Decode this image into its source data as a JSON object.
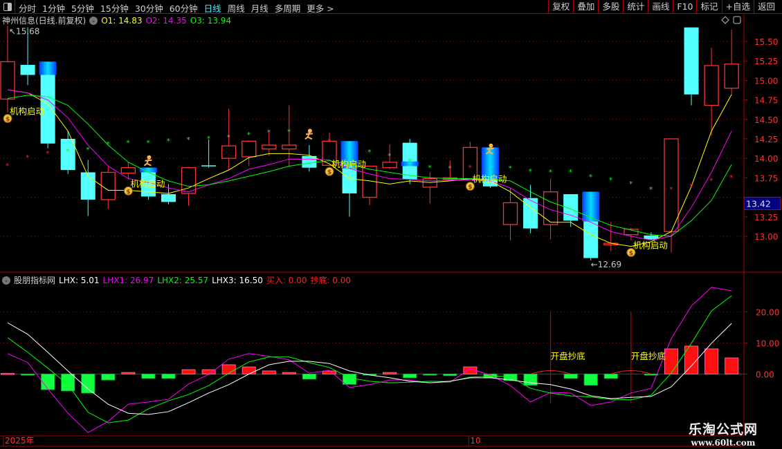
{
  "toolbar": {
    "periods": [
      "分时",
      "1分钟",
      "5分钟",
      "15分钟",
      "30分钟",
      "60分钟",
      "日线",
      "周线",
      "月线",
      "多周期",
      "更多 >"
    ],
    "active_period": "日线",
    "buttons": [
      "复权",
      "叠加",
      "多股",
      "统计",
      "画线",
      "F10",
      "标记",
      "+自选",
      "返回"
    ]
  },
  "main_header": {
    "title": "神州信息(日线.前复权)",
    "o1": "O1: 14.83",
    "o2": "O2: 14.35",
    "o3": "O3: 13.94"
  },
  "indicator_header": {
    "name": "股朋指标网",
    "lhx": "LHX: 5.01",
    "lhx1": "LHX1: 26.97",
    "lhx2": "LHX2: 25.57",
    "lhx3": "LHX3: 16.50",
    "buy": "买入: 0.00",
    "bottom": "抄底: 0.00"
  },
  "colors": {
    "up": "#ff3232",
    "down": "#54ffff",
    "ma1": "#ffff00",
    "ma2": "#ff00ff",
    "ma3": "#00ff00",
    "grid": "#a00000",
    "lhx3": "#ffffff"
  },
  "watermark": {
    "name": "乐淘公式网",
    "url": "www.60lt.com"
  },
  "time_axis": {
    "labels": [
      {
        "text": "2025年",
        "index": 0
      },
      {
        "text": "10",
        "index": 23
      }
    ]
  },
  "chart_data": [
    {
      "type": "candlestick",
      "title": "神州信息(日线.前复权)",
      "ylim": [
        12.55,
        15.75
      ],
      "yticks": [
        "15.50",
        "15.25",
        "15.00",
        "14.75",
        "14.50",
        "14.25",
        "14.00",
        "13.75",
        "13.25",
        "13.00"
      ],
      "ytick_values": [
        15.5,
        15.25,
        15.0,
        14.75,
        14.5,
        14.25,
        14.0,
        13.75,
        13.25,
        13.0
      ],
      "last_price_label": "13.42",
      "last_price": 13.42,
      "high_label": "15.68",
      "high_index": 1,
      "low_label": "12.69",
      "low_index": 29,
      "ohlc": [
        [
          14.76,
          15.7,
          14.59,
          15.24
        ],
        [
          15.2,
          15.68,
          14.94,
          15.07
        ],
        [
          15.24,
          15.24,
          14.13,
          14.19
        ],
        [
          14.25,
          14.35,
          13.8,
          13.85
        ],
        [
          13.82,
          13.98,
          13.26,
          13.47
        ],
        [
          13.47,
          13.89,
          13.35,
          13.82
        ],
        [
          13.81,
          13.95,
          13.73,
          13.88
        ],
        [
          13.88,
          13.88,
          13.47,
          13.51
        ],
        [
          13.54,
          13.67,
          13.41,
          13.44
        ],
        [
          13.55,
          13.89,
          13.39,
          13.88
        ],
        [
          13.91,
          14.24,
          13.88,
          13.9
        ],
        [
          14.0,
          14.64,
          13.85,
          14.16
        ],
        [
          14.02,
          14.23,
          13.9,
          14.22
        ],
        [
          14.12,
          14.33,
          14.03,
          14.17
        ],
        [
          14.12,
          14.68,
          13.89,
          14.17
        ],
        [
          14.03,
          14.17,
          13.83,
          13.88
        ],
        [
          13.91,
          14.33,
          13.9,
          14.22
        ],
        [
          14.22,
          14.22,
          13.25,
          13.55
        ],
        [
          13.5,
          13.9,
          13.4,
          13.9
        ],
        [
          13.88,
          14.18,
          13.86,
          13.95
        ],
        [
          14.2,
          14.25,
          13.67,
          13.73
        ],
        [
          13.63,
          13.82,
          13.42,
          13.74
        ],
        [
          13.73,
          13.97,
          13.72,
          13.75
        ],
        [
          13.73,
          14.21,
          13.72,
          14.14
        ],
        [
          14.14,
          14.14,
          13.62,
          13.64
        ],
        [
          13.15,
          13.62,
          12.95,
          13.43
        ],
        [
          13.49,
          13.66,
          13.04,
          13.1
        ],
        [
          13.15,
          13.74,
          12.96,
          13.57
        ],
        [
          13.54,
          13.54,
          13.12,
          13.2
        ],
        [
          13.57,
          13.57,
          12.69,
          12.72
        ],
        [
          12.89,
          13.18,
          12.81,
          12.91
        ],
        [
          13.02,
          13.11,
          12.95,
          13.09
        ],
        [
          13.01,
          13.05,
          12.95,
          12.96
        ],
        [
          13.06,
          14.25,
          12.79,
          14.25
        ],
        [
          15.68,
          15.68,
          14.68,
          14.82
        ],
        [
          14.68,
          15.42,
          14.29,
          15.19
        ],
        [
          14.9,
          15.65,
          14.82,
          15.21
        ]
      ],
      "highlight_bands": [
        {
          "index": 2,
          "from": 15.24,
          "to": 15.07
        },
        {
          "index": 7,
          "from": 13.88,
          "to": 13.82
        },
        {
          "index": 17,
          "from": 14.22,
          "to": 13.87
        },
        {
          "index": 20,
          "from": 13.96,
          "to": 13.9
        },
        {
          "index": 24,
          "from": 14.14,
          "to": 13.73
        },
        {
          "index": 29,
          "from": 13.57,
          "to": 13.19
        }
      ],
      "series": [
        {
          "name": "O1",
          "color": "#ffff00",
          "values": [
            14.88,
            14.84,
            14.7,
            14.35,
            13.77,
            13.59,
            13.59,
            13.57,
            13.55,
            13.62,
            13.74,
            13.85,
            14.01,
            14.06,
            14.06,
            14.04,
            13.93,
            13.74,
            13.71,
            13.67,
            13.71,
            13.69,
            13.71,
            13.74,
            13.71,
            13.57,
            13.37,
            13.18,
            13.18,
            13.02,
            12.91,
            12.87,
            12.93,
            13.06,
            13.64,
            14.35,
            14.82
          ]
        },
        {
          "name": "O2",
          "color": "#ff00ff",
          "values": [
            14.88,
            14.84,
            14.75,
            14.52,
            14.17,
            13.9,
            13.74,
            13.69,
            13.62,
            13.57,
            13.66,
            13.74,
            13.86,
            13.92,
            13.99,
            13.99,
            13.98,
            13.87,
            13.8,
            13.74,
            13.73,
            13.71,
            13.72,
            13.72,
            13.71,
            13.62,
            13.46,
            13.34,
            13.27,
            13.18,
            13.06,
            13.0,
            12.95,
            13.0,
            13.37,
            13.82,
            14.35
          ]
        },
        {
          "name": "O3",
          "color": "#00ff00",
          "values": [
            14.77,
            14.81,
            14.79,
            14.68,
            14.44,
            14.17,
            13.95,
            13.82,
            13.71,
            13.64,
            13.66,
            13.71,
            13.77,
            13.83,
            13.9,
            13.94,
            13.97,
            13.92,
            13.86,
            13.82,
            13.78,
            13.75,
            13.74,
            13.74,
            13.73,
            13.71,
            13.57,
            13.44,
            13.35,
            13.24,
            13.14,
            13.08,
            13.02,
            13.0,
            13.2,
            13.46,
            13.92
          ]
        }
      ],
      "stars": [
        {
          "i": 0,
          "p": 13.92,
          "c": "red"
        },
        {
          "i": 1,
          "p": 14.03,
          "c": "red"
        },
        {
          "i": 2,
          "p": 14.08,
          "c": "red"
        },
        {
          "i": 3,
          "p": 14.11,
          "c": "green"
        },
        {
          "i": 4,
          "p": 14.13,
          "c": "green"
        },
        {
          "i": 5,
          "p": 14.2,
          "c": "green"
        },
        {
          "i": 6,
          "p": 14.22,
          "c": "green"
        },
        {
          "i": 7,
          "p": 14.22,
          "c": "green"
        },
        {
          "i": 8,
          "p": 14.24,
          "c": "green"
        },
        {
          "i": 9,
          "p": 14.26,
          "c": "gray"
        },
        {
          "i": 10,
          "p": 14.27,
          "c": "green"
        },
        {
          "i": 11,
          "p": 14.29,
          "c": "gray"
        },
        {
          "i": 12,
          "p": 14.32,
          "c": "green"
        },
        {
          "i": 13,
          "p": 14.35,
          "c": "gray"
        },
        {
          "i": 14,
          "p": 14.36,
          "c": "green"
        },
        {
          "i": 15,
          "p": 14.33,
          "c": "gray"
        },
        {
          "i": 16,
          "p": 14.24,
          "c": "red"
        },
        {
          "i": 18,
          "p": 14.1,
          "c": "green"
        },
        {
          "i": 19,
          "p": 14.05,
          "c": "gray"
        },
        {
          "i": 20,
          "p": 13.98,
          "c": "green"
        },
        {
          "i": 21,
          "p": 13.9,
          "c": "green"
        },
        {
          "i": 22,
          "p": 13.89,
          "c": "gray"
        },
        {
          "i": 23,
          "p": 13.9,
          "c": "red"
        },
        {
          "i": 25,
          "p": 13.89,
          "c": "green"
        },
        {
          "i": 26,
          "p": 13.85,
          "c": "green"
        },
        {
          "i": 27,
          "p": 13.84,
          "c": "green"
        },
        {
          "i": 28,
          "p": 13.84,
          "c": "green"
        },
        {
          "i": 29,
          "p": 13.78,
          "c": "green"
        },
        {
          "i": 30,
          "p": 13.74,
          "c": "green"
        },
        {
          "i": 31,
          "p": 13.69,
          "c": "green"
        },
        {
          "i": 32,
          "p": 13.62,
          "c": "gray"
        },
        {
          "i": 33,
          "p": 13.62,
          "c": "red"
        },
        {
          "i": 34,
          "p": 13.66,
          "c": "red"
        },
        {
          "i": 35,
          "p": 13.73,
          "c": "red"
        },
        {
          "i": 36,
          "p": 13.77,
          "c": "red"
        }
      ],
      "signal_label": "机构启动",
      "signals": [
        {
          "i": 0,
          "p": 14.6
        },
        {
          "i": 6,
          "p": 13.67
        },
        {
          "i": 16,
          "p": 13.92
        },
        {
          "i": 23,
          "p": 13.73
        },
        {
          "i": 31,
          "p": 12.88
        }
      ],
      "runners": [
        {
          "i": 7,
          "p": 13.96
        },
        {
          "i": 15,
          "p": 14.3
        },
        {
          "i": 24,
          "p": 14.11
        }
      ]
    },
    {
      "type": "bar",
      "title": "股朋指标网",
      "ylim": [
        -22,
        30
      ],
      "yticks": [
        "20.00",
        "10.00",
        "0.00"
      ],
      "ytick_values": [
        20,
        10,
        0
      ],
      "histogram": [
        0.2,
        -0.3,
        -5.0,
        -5.4,
        -6.1,
        -1.9,
        0.5,
        -1.4,
        -1.4,
        1.4,
        1.4,
        3.0,
        2.3,
        1.0,
        0.5,
        -1.6,
        1.0,
        -3.3,
        -0.3,
        0.5,
        -1.2,
        -0.3,
        -0.5,
        2.3,
        -1.2,
        -2.1,
        -3.6,
        0,
        -1.4,
        -3.6,
        -1.4,
        0,
        -0.3,
        8.1,
        9.0,
        8.1,
        5.2
      ],
      "series": [
        {
          "name": "LHX1",
          "color": "#ff00ff",
          "values": [
            6.6,
            3.7,
            -4.8,
            -12.6,
            -18.8,
            -15.2,
            -9.7,
            -9.0,
            -8.1,
            -3.2,
            -0.1,
            4.8,
            6.6,
            5.7,
            4.6,
            0.3,
            1.2,
            -4.3,
            -3.4,
            -1.9,
            -1.9,
            -2.8,
            -2.6,
            1.7,
            -0.3,
            -3.7,
            -9.0,
            -5.9,
            -6.1,
            -10.1,
            -9.0,
            -6.1,
            -4.6,
            11.4,
            21.9,
            27.9,
            26.8
          ]
        },
        {
          "name": "LHX2",
          "color": "#00ff00",
          "values": [
            11.7,
            7.0,
            1.9,
            -3.4,
            -12.3,
            -15.7,
            -14.8,
            -11.2,
            -8.6,
            -6.6,
            -3.7,
            0.3,
            3.9,
            5.5,
            5.5,
            3.7,
            2.1,
            -1.2,
            -2.3,
            -2.8,
            -2.6,
            -2.3,
            -2.4,
            -1.0,
            -0.6,
            -0.8,
            -4.6,
            -6.1,
            -7.0,
            -7.4,
            -8.1,
            -8.3,
            -6.8,
            0.3,
            9.9,
            20.3,
            25.2
          ]
        },
        {
          "name": "LHX3",
          "color": "#ffffff",
          "values": [
            16.5,
            12.8,
            7.0,
            1.0,
            -4.8,
            -9.7,
            -12.6,
            -13.0,
            -12.1,
            -9.2,
            -6.1,
            -3.4,
            0.0,
            3.0,
            4.1,
            4.1,
            3.4,
            1.0,
            -0.3,
            -1.2,
            -2.3,
            -2.8,
            -2.3,
            -1.2,
            -1.2,
            -1.9,
            -2.8,
            -3.4,
            -4.8,
            -7.0,
            -7.9,
            -7.5,
            -7.2,
            -4.1,
            2.6,
            9.9,
            16.3
          ]
        }
      ],
      "event_label": "开盘抄底",
      "events": [
        27,
        31
      ]
    }
  ]
}
